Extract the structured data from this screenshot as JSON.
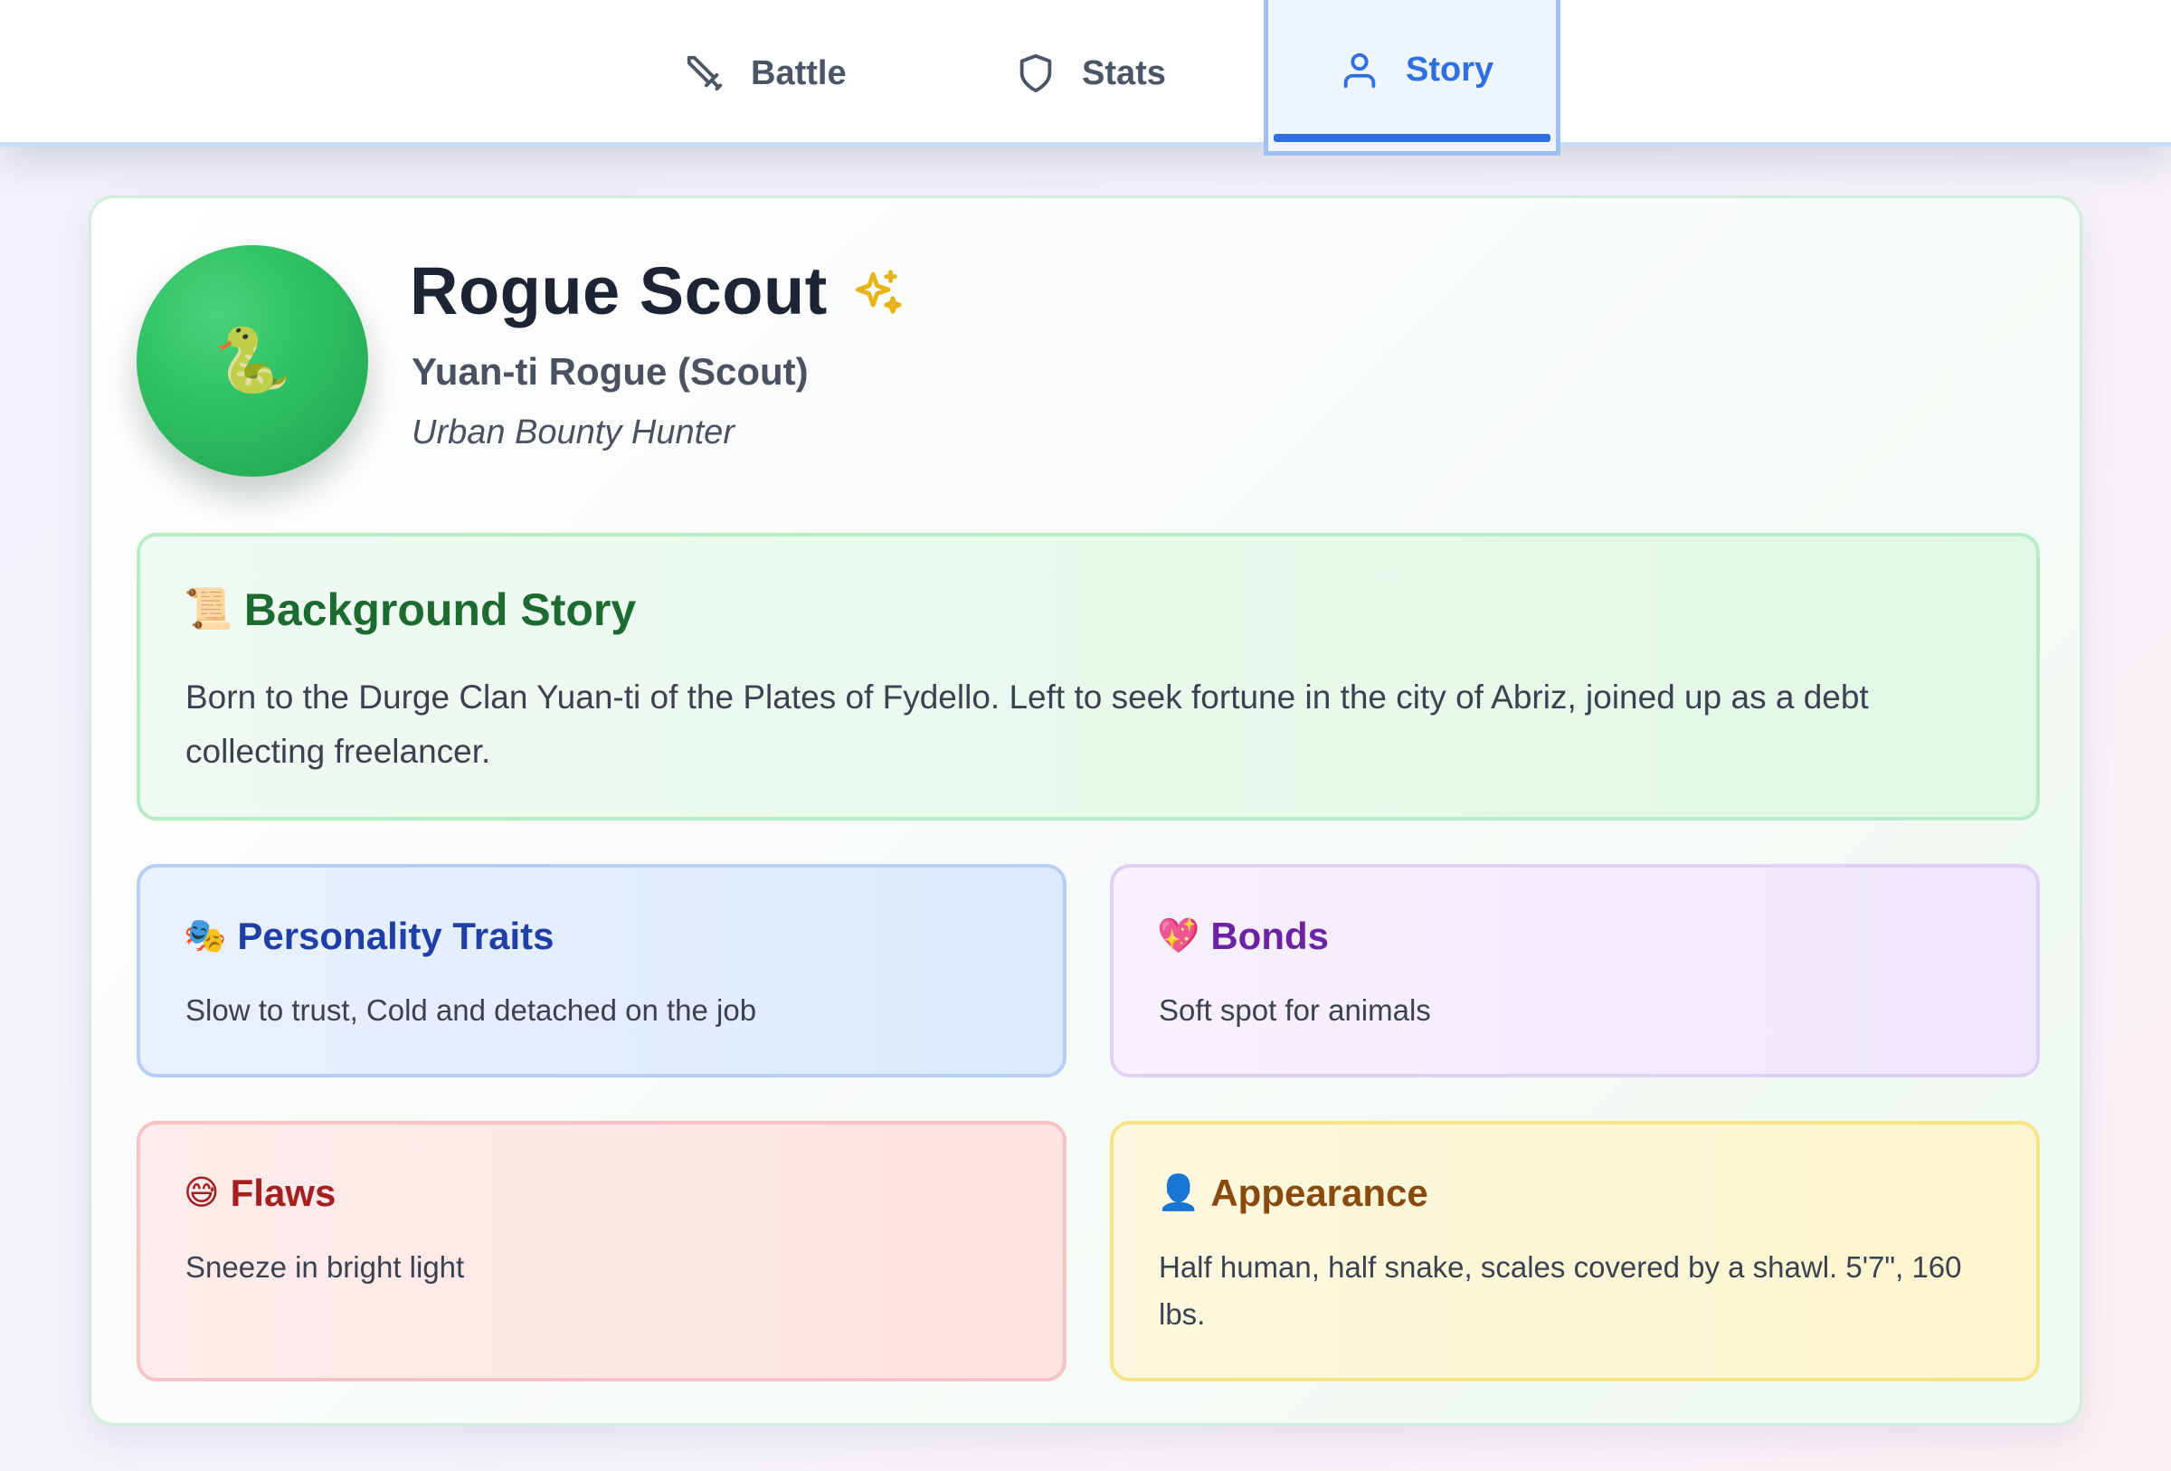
{
  "nav": {
    "tabs": [
      {
        "label": "Battle",
        "icon": "sword-icon"
      },
      {
        "label": "Stats",
        "icon": "shield-icon"
      },
      {
        "label": "Story",
        "icon": "user-icon",
        "active": true
      }
    ],
    "active_color": "#2f6fe0"
  },
  "character": {
    "avatar_emoji": "🐍",
    "name": "Rogue Scout",
    "name_icon": "sparkles-icon",
    "subtitle": "Yuan-ti Rogue (Scout)",
    "tagline": "Urban Bounty Hunter"
  },
  "background": {
    "emoji": "📜",
    "title": "Background Story",
    "text": "Born to the Durge Clan Yuan-ti of the Plates of Fydello. Left to seek fortune in the city of Abriz, joined up as a debt collecting freelancer."
  },
  "personality": {
    "emoji": "🎭",
    "title": "Personality Traits",
    "text": "Slow to trust, Cold and detached on the job"
  },
  "bonds": {
    "emoji": "💖",
    "title": "Bonds",
    "text": "Soft spot for animals"
  },
  "flaws": {
    "emoji": "😅",
    "title": "Flaws",
    "text": "Sneeze in bright light"
  },
  "appearance": {
    "emoji": "👤",
    "title": "Appearance",
    "text": "Half human, half snake, scales covered by a shawl. 5'7\", 160 lbs."
  }
}
